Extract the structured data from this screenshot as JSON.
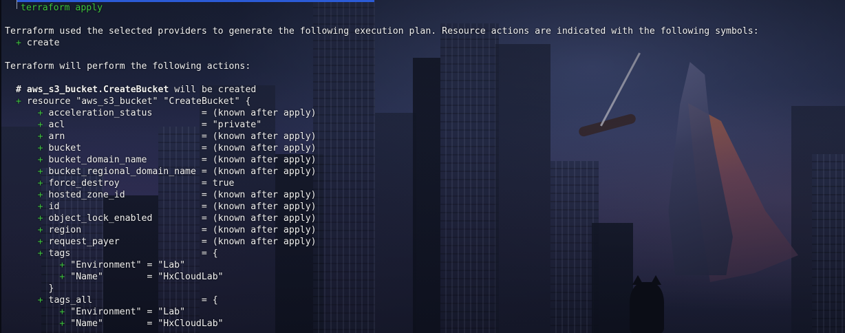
{
  "window": {
    "app": "Terminal"
  },
  "terminal": {
    "command": "terraform apply",
    "intro": "Terraform used the selected providers to generate the following execution plan. Resource actions are indicated with the following symbols:",
    "symbol_create": "+ create",
    "perform": "Terraform will perform the following actions:",
    "resource_comment_prefix": "# ",
    "resource_address": "aws_s3_bucket.CreateBucket",
    "resource_comment_suffix": " will be created",
    "resource_decl": "+ resource \"aws_s3_bucket\" \"CreateBucket\" {",
    "lines": [
      {
        "indent": "      ",
        "sym": "+",
        "text": " acceleration_status         = (known after apply)"
      },
      {
        "indent": "      ",
        "sym": "+",
        "text": " acl                         = \"private\""
      },
      {
        "indent": "      ",
        "sym": "+",
        "text": " arn                         = (known after apply)"
      },
      {
        "indent": "      ",
        "sym": "+",
        "text": " bucket                      = (known after apply)"
      },
      {
        "indent": "      ",
        "sym": "+",
        "text": " bucket_domain_name          = (known after apply)"
      },
      {
        "indent": "      ",
        "sym": "+",
        "text": " bucket_regional_domain_name = (known after apply)"
      },
      {
        "indent": "      ",
        "sym": "+",
        "text": " force_destroy               = true"
      },
      {
        "indent": "      ",
        "sym": "+",
        "text": " hosted_zone_id              = (known after apply)"
      },
      {
        "indent": "      ",
        "sym": "+",
        "text": " id                          = (known after apply)"
      },
      {
        "indent": "      ",
        "sym": "+",
        "text": " object_lock_enabled         = (known after apply)"
      },
      {
        "indent": "      ",
        "sym": "+",
        "text": " region                      = (known after apply)"
      },
      {
        "indent": "      ",
        "sym": "+",
        "text": " request_payer               = (known after apply)"
      },
      {
        "indent": "      ",
        "sym": "+",
        "text": " tags                        = {"
      },
      {
        "indent": "          ",
        "sym": "+",
        "text": " \"Environment\" = \"Lab\""
      },
      {
        "indent": "          ",
        "sym": "+",
        "text": " \"Name\"        = \"HxCloudLab\""
      },
      {
        "indent": "        ",
        "sym": "",
        "text": "}"
      },
      {
        "indent": "      ",
        "sym": "+",
        "text": " tags_all                    = {"
      },
      {
        "indent": "          ",
        "sym": "+",
        "text": " \"Environment\" = \"Lab\""
      },
      {
        "indent": "          ",
        "sym": "+",
        "text": " \"Name\"        = \"HxCloudLab\""
      }
    ]
  },
  "colors": {
    "plus_green": "#3ec43e",
    "text": "#f2f2f2",
    "prompt_bar": "#2b5bd6"
  }
}
